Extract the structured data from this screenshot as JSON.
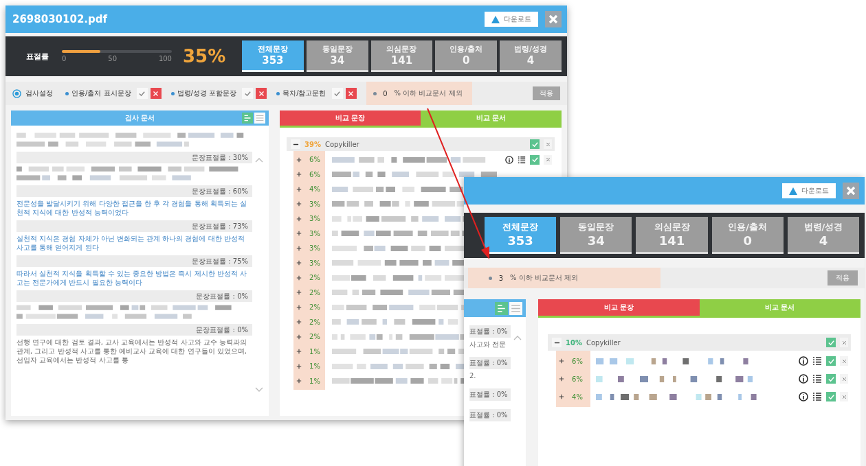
{
  "windows": [
    {
      "title": "2698030102.pdf",
      "download": "다운로드",
      "score_label": "표절률",
      "slider": {
        "level": 0.35,
        "ticks": [
          "0",
          "50",
          "100"
        ]
      },
      "score": "35%",
      "tabs": [
        {
          "label": "전체문장",
          "count": "353",
          "selected": true
        },
        {
          "label": "동일문장",
          "count": "34",
          "selected": false
        },
        {
          "label": "의심문장",
          "count": "141",
          "selected": false
        },
        {
          "label": "인용/출처",
          "count": "0",
          "selected": false
        },
        {
          "label": "법령/성경",
          "count": "4",
          "selected": false
        }
      ],
      "settings_label": "검사설정",
      "filters": [
        {
          "label": "인용/출처 표시문장",
          "excluded": true
        },
        {
          "label": "법령/성경 포함문장",
          "excluded": true
        },
        {
          "label": "목차/참고문헌",
          "excluded": true
        }
      ],
      "exclusion": {
        "value": "0",
        "label": "% 이하 비교문서 제외"
      },
      "apply": "적용",
      "source_panel": {
        "title": "검사 문서",
        "sentences": [
          {
            "kind": "blurred"
          },
          {
            "rate": "문장표절률 : 30%",
            "kind": "blurred"
          },
          {
            "rate": "문장표절률 : 60%",
            "kind": "matched",
            "text": "전문성을 발달시키기 위해 다양한 접근을 한 후 각 경험을 통해 획득되는 실천적 지식에 대한 반성적 능력이었다"
          },
          {
            "rate": "문장표절률 : 73%",
            "kind": "matched",
            "text": "실천적 지식은 경험 자체가 아닌 변화되는 관계 하나의 경험에 대한 반성적 사고를 통해 얻어지게 된다"
          },
          {
            "rate": "문장표절률 : 75%",
            "kind": "matched",
            "text": "따라서 실천적 지식을 획득할 수 있는 중요한 방법은 즉시 제시한 반성적 사고는 전문가에게 반드시 필요한 능력이다"
          },
          {
            "rate": "문장표절률 : 0%",
            "kind": "blurred"
          },
          {
            "rate": "문장표절률 : 0%",
            "kind": "plain",
            "text": "선행 연구에 대한 검토 결과, 교사 교육에서는 반성적 사고와 교수 능력과의 관계, 그리고 반성적 사고를 통한 예비교사 교육에 대한 연구들이 있었으며, 선임자 교육에서는 반성적 사고를 통"
          }
        ]
      },
      "compare_tabs": [
        {
          "label": "비교 문장",
          "color": "#e8484f"
        },
        {
          "label": "비교 문서",
          "color": "#8fcf45"
        }
      ],
      "group": {
        "percent": "39%",
        "color": "#f0a53c",
        "name": "Copykiller",
        "expanded": true,
        "rows": [
          {
            "percent": "6%",
            "tools": true
          },
          {
            "percent": "6%",
            "tools": false
          },
          {
            "percent": "4%"
          },
          {
            "percent": "3%"
          },
          {
            "percent": "3%"
          },
          {
            "percent": "3%"
          },
          {
            "percent": "3%"
          },
          {
            "percent": "3%"
          },
          {
            "percent": "2%"
          },
          {
            "percent": "2%"
          },
          {
            "percent": "2%"
          },
          {
            "percent": "2%"
          },
          {
            "percent": "2%"
          },
          {
            "percent": "1%"
          },
          {
            "percent": "1%"
          },
          {
            "percent": "1%"
          }
        ]
      }
    },
    {
      "download": "다운로드",
      "tabs": [
        {
          "label": "전체문장",
          "count": "353",
          "selected": true
        },
        {
          "label": "동일문장",
          "count": "34",
          "selected": false
        },
        {
          "label": "의심문장",
          "count": "141",
          "selected": false
        },
        {
          "label": "인용/출처",
          "count": "0",
          "selected": false
        },
        {
          "label": "법령/성경",
          "count": "4",
          "selected": false
        }
      ],
      "exclusion": {
        "value": "3",
        "label": "% 이하 비교문서 제외"
      },
      "apply": "적용",
      "source_panel": {
        "sentences": [
          {
            "rate": "표절률 : 0%",
            "kind": "plain",
            "text": "사고와 전문"
          },
          {
            "rate": "표절률 : 0%",
            "kind": "plain",
            "text": "2."
          },
          {
            "rate": "표절률 : 0%"
          },
          {
            "rate": "표절률 : 0%"
          }
        ]
      },
      "compare_tabs": [
        {
          "label": "비교 문장",
          "color": "#e8484f"
        },
        {
          "label": "비교 문서",
          "color": "#8fcf45"
        }
      ],
      "group": {
        "percent": "10%",
        "color": "#3bb37a",
        "name": "Copykiller",
        "expanded": true,
        "rows": [
          {
            "percent": "6%",
            "tools": true
          },
          {
            "percent": "6%",
            "tools": true
          },
          {
            "percent": "4%",
            "tools": true
          }
        ]
      }
    }
  ]
}
